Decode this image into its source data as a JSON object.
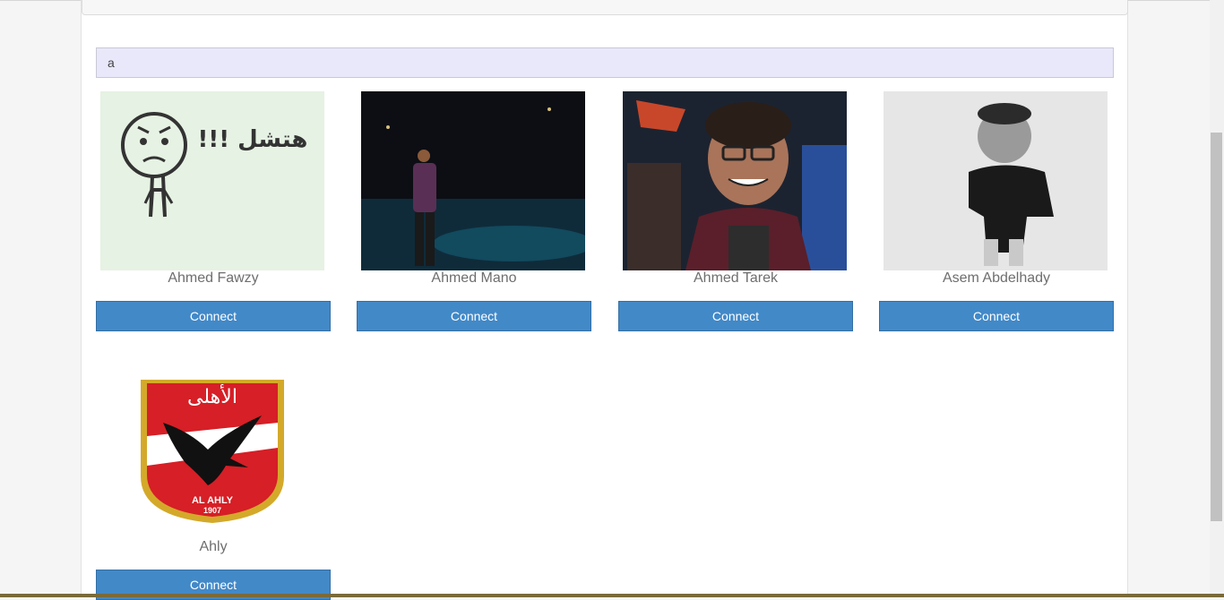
{
  "search": {
    "value": "a"
  },
  "people": [
    {
      "name": "Ahmed Fawzy",
      "button": "Connect",
      "photo_icon": "sketch-person-icon",
      "photo_caption": "!!! هتشل"
    },
    {
      "name": "Ahmed Mano",
      "button": "Connect",
      "photo_icon": "person-photo-icon"
    },
    {
      "name": "Ahmed Tarek",
      "button": "Connect",
      "photo_icon": "person-photo-icon"
    },
    {
      "name": "Asem Abdelhady",
      "button": "Connect",
      "photo_icon": "person-photo-icon"
    },
    {
      "name": "Ahly",
      "button": "Connect",
      "photo_icon": "club-crest-icon",
      "crest_text_ar": "الأهلى",
      "crest_text": "AL AHLY",
      "crest_year": "1907"
    }
  ],
  "colors": {
    "button": "#4289c8",
    "search_bg": "#e8e8fa",
    "name_text": "#6e6e6e"
  }
}
